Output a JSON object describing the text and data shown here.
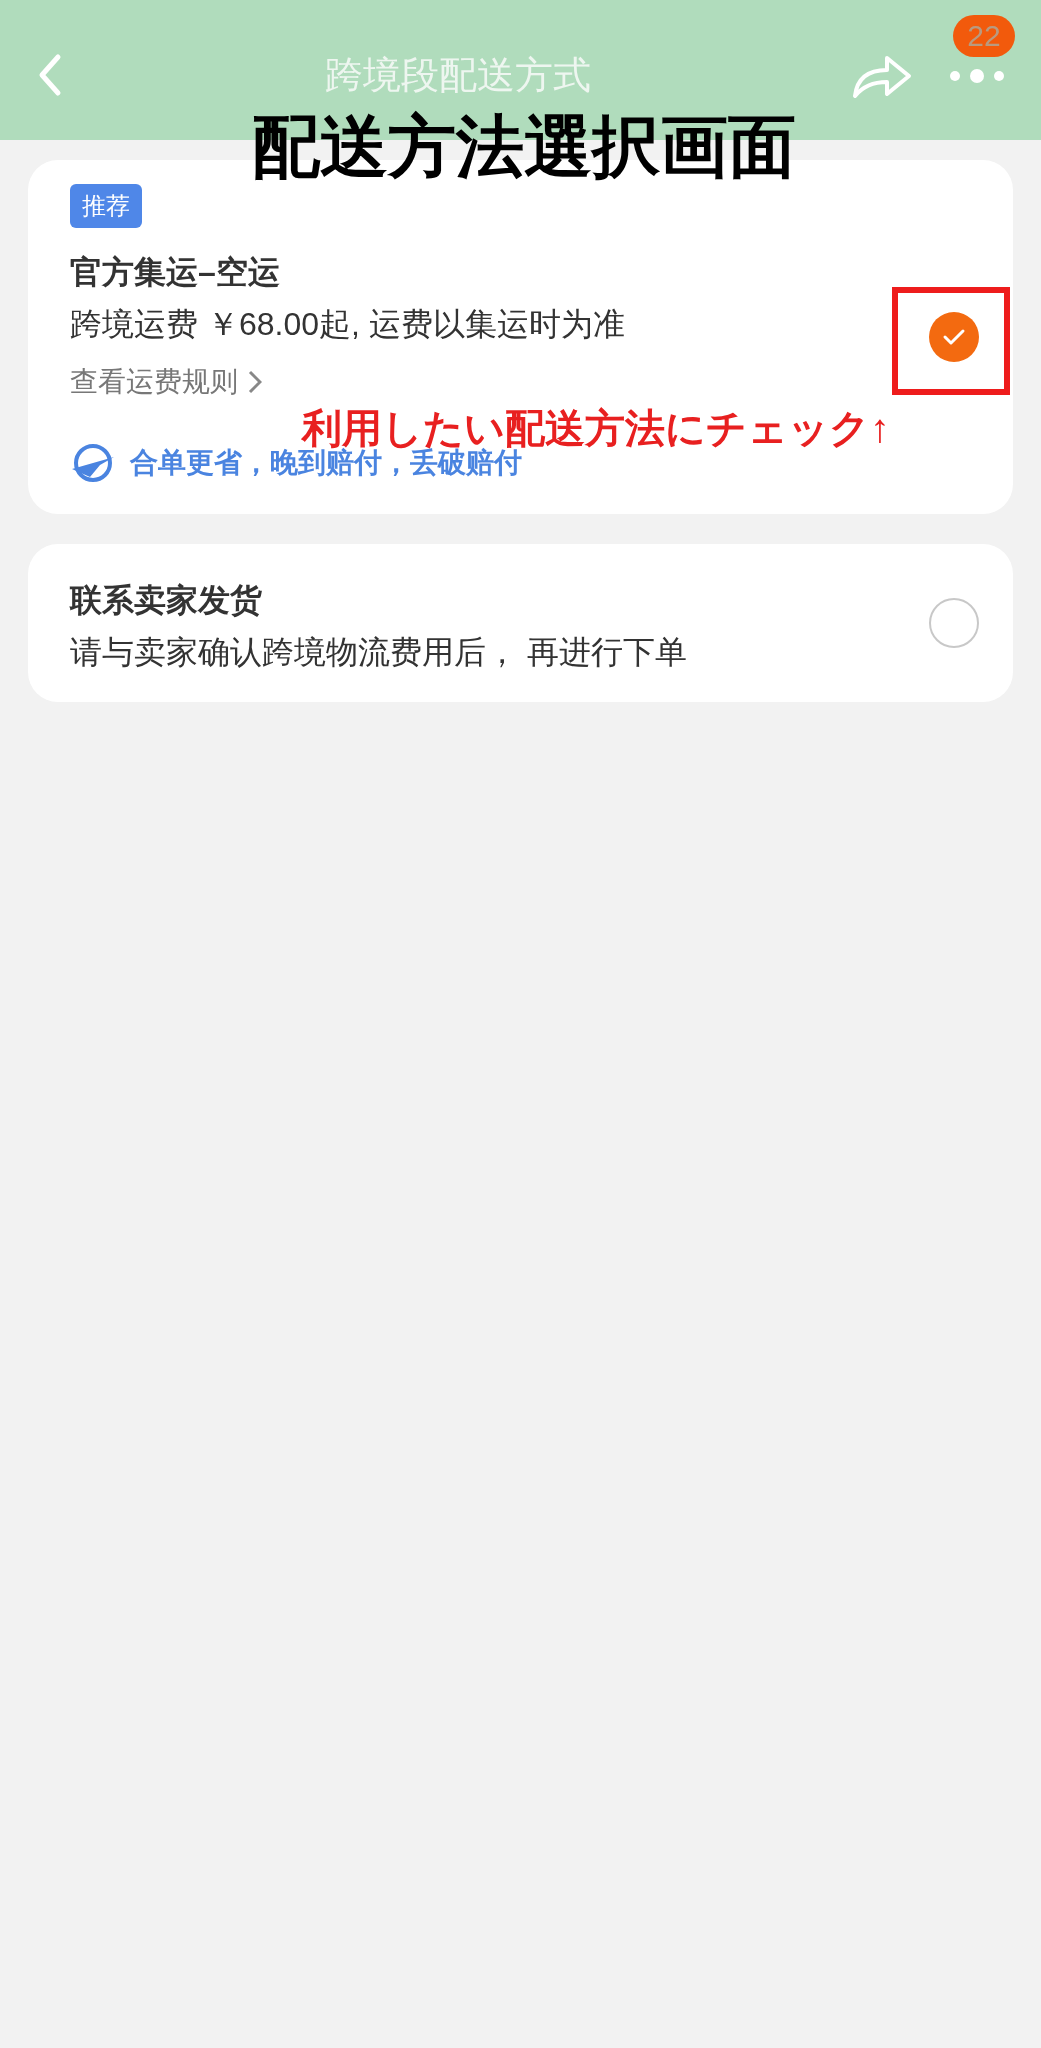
{
  "header": {
    "title": "跨境段配送方式",
    "badge": "22"
  },
  "annotation": {
    "heading": "配送方法選択画面",
    "note": "利用したい配送方法にチェック↑"
  },
  "options": [
    {
      "tag": "推荐",
      "title": "官方集运–空运",
      "description": "跨境运费 ￥68.00起, 运费以集运时为准",
      "link": "查看运费规则",
      "perks": "合单更省，晚到赔付，丢破赔付",
      "selected": true
    },
    {
      "title": "联系卖家发货",
      "description": "请与卖家确认跨境物流费用后， 再进行下单",
      "selected": false
    }
  ]
}
